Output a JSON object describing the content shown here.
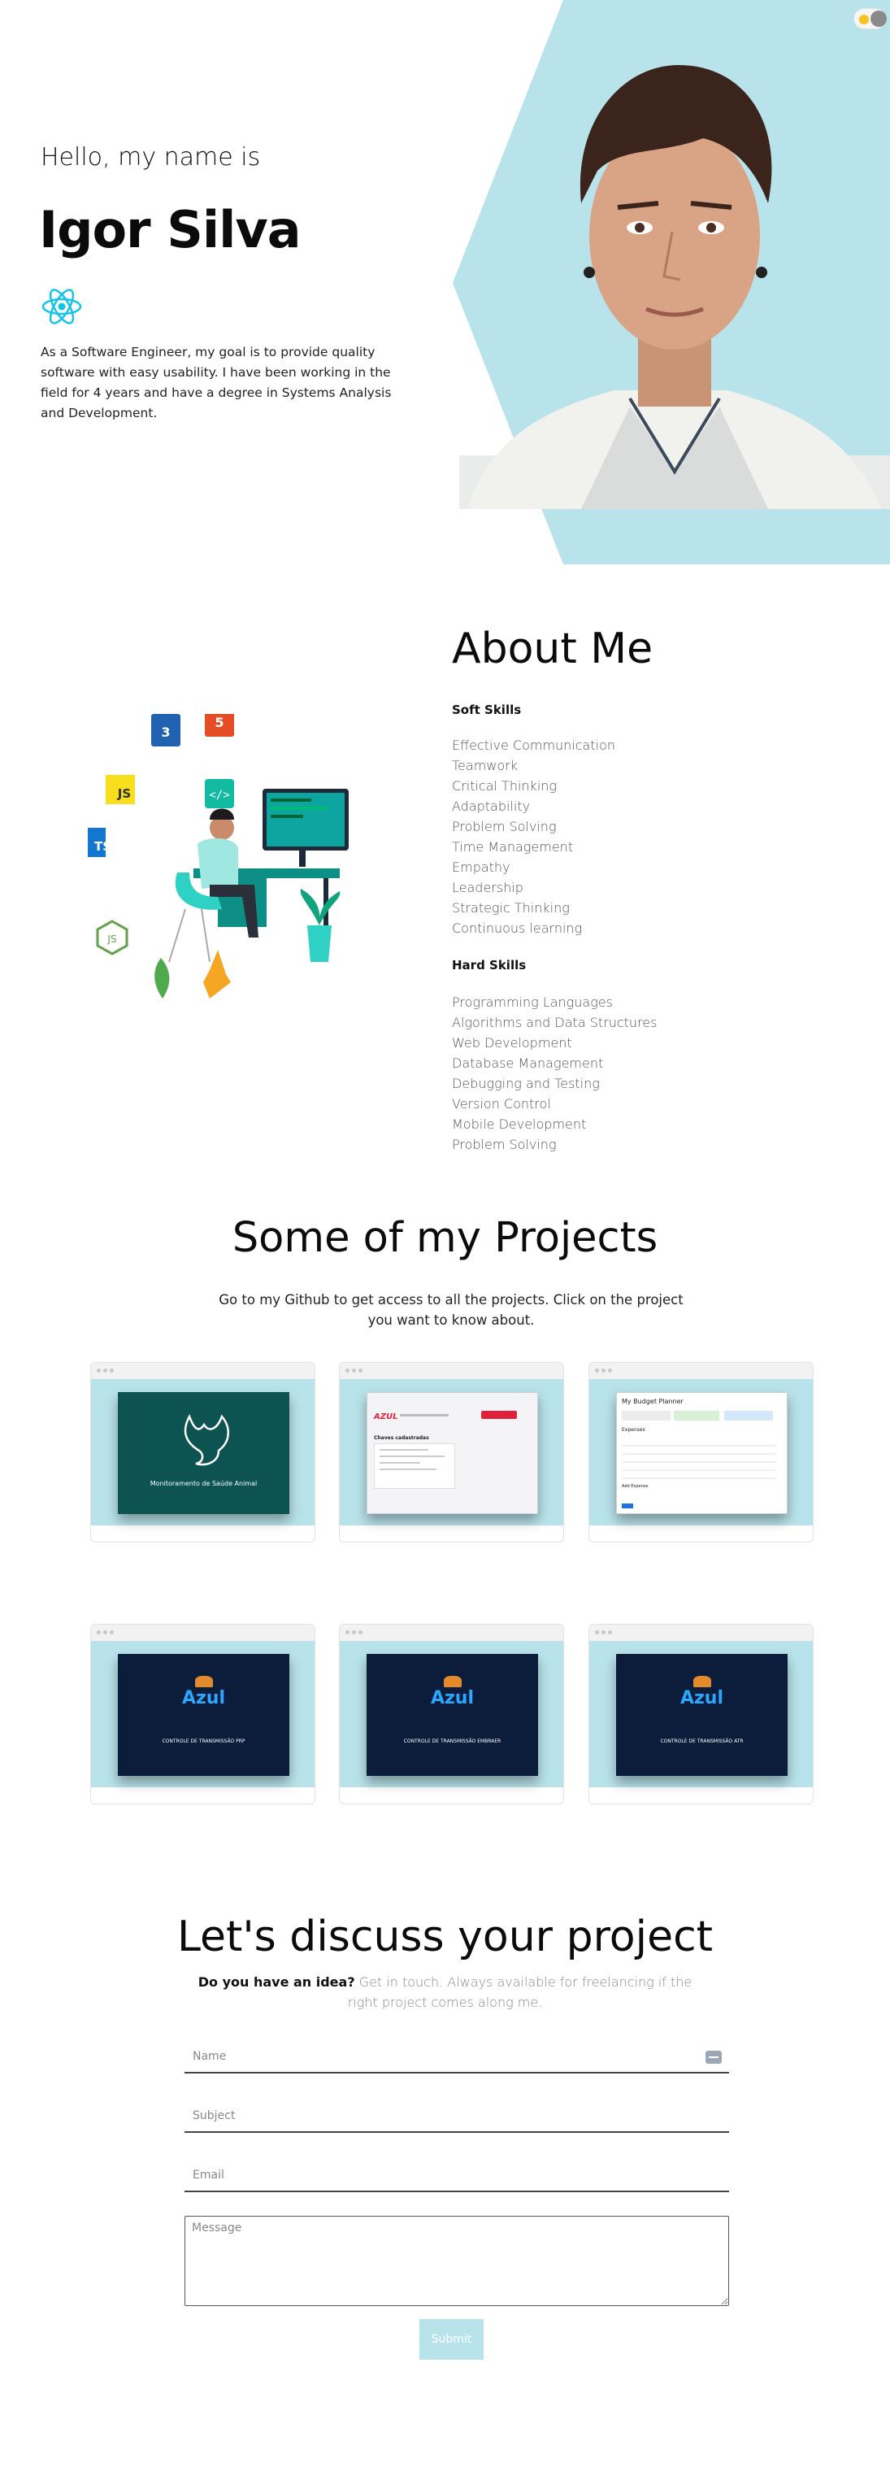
{
  "colors": {
    "accent": "#b9e3ea",
    "dark_text": "#0b0b0b",
    "muted_text": "#555555"
  },
  "hero": {
    "greeting": "Hello, my name is",
    "name": "Igor Silva",
    "description": "As a Software Engineer, my goal is to provide quality software with easy usability. I have been working in the field for 4 years and have a degree in Systems Analysis and Development."
  },
  "about": {
    "title": "About Me",
    "soft_heading": "Soft Skills",
    "soft_skills": [
      "Effective Communication",
      "Teamwork",
      "Critical Thinking",
      "Adaptability",
      "Problem Solving",
      "Time Management",
      "Empathy",
      "Leadership",
      "Strategic Thinking",
      "Continuous learning"
    ],
    "hard_heading": "Hard Skills",
    "hard_skills": [
      "Programming Languages",
      "Algorithms and Data Structures",
      "Web Development",
      "Database Management",
      "Debugging and Testing",
      "Version Control",
      "Mobile Development",
      "Problem Solving"
    ]
  },
  "projects": {
    "title": "Some of my Projects",
    "subtitle": "Go to my Github to get access to all the projects. Click on the project you want to know about.",
    "items": [
      {
        "caption": "Monitoramento de Saúde Animal"
      },
      {
        "brand": "AZUL",
        "heading": "Chaves cadastradas",
        "button": ""
      },
      {
        "heading": "My Budget Planner",
        "section": "Expenses",
        "section2": "Add Expense"
      },
      {
        "brand": "Azul",
        "caption": "CONTROLE DE TRANSMISSÃO PRP"
      },
      {
        "brand": "Azul",
        "caption": "CONTROLE DE TRANSMISSÃO EMBRAER"
      },
      {
        "brand": "Azul",
        "caption": "CONTROLE DE TRANSMISSÃO ATR"
      }
    ]
  },
  "contact": {
    "title": "Let's discuss your project",
    "lead_bold": "Do you have an idea?",
    "lead_rest": " Get in touch. Always available for freelancing if the right project comes along me.",
    "name_placeholder": "Name",
    "subject_placeholder": "Subject",
    "email_placeholder": "Email",
    "message_placeholder": "Message",
    "submit_label": "Submit"
  }
}
